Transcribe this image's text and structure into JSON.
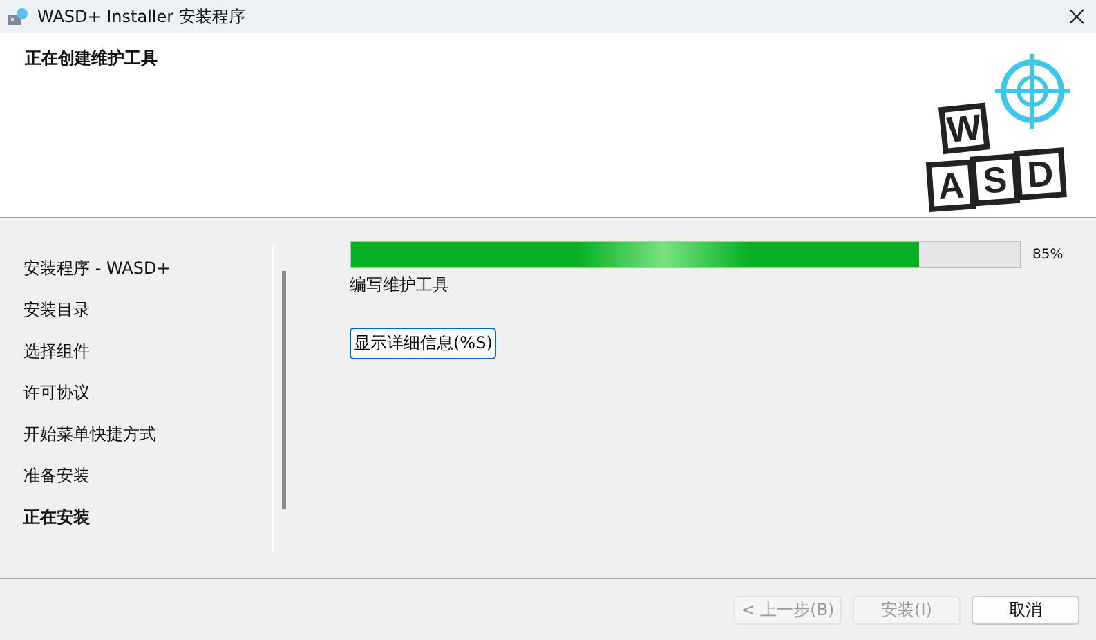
{
  "window": {
    "title": "WASD+ Installer 安装程序"
  },
  "header": {
    "title": "正在创建维护工具",
    "logo_letters": [
      "W",
      "A",
      "S",
      "D"
    ]
  },
  "sidebar": {
    "items": [
      {
        "label": "安装程序 - WASD+",
        "selected": false
      },
      {
        "label": "安装目录",
        "selected": false
      },
      {
        "label": "选择组件",
        "selected": false
      },
      {
        "label": "许可协议",
        "selected": false
      },
      {
        "label": "开始菜单快捷方式",
        "selected": false
      },
      {
        "label": "准备安装",
        "selected": false
      },
      {
        "label": "正在安装",
        "selected": true
      }
    ]
  },
  "progress": {
    "level": 0.85,
    "reading": "85%",
    "status": "编写维护工具"
  },
  "details_button": "显示详细信息(%S)",
  "buttons": [
    {
      "label": "< 上一步(B)",
      "disabled": true
    },
    {
      "label": "安装(I)",
      "disabled": true
    },
    {
      "label": "取消",
      "disabled": false
    }
  ]
}
